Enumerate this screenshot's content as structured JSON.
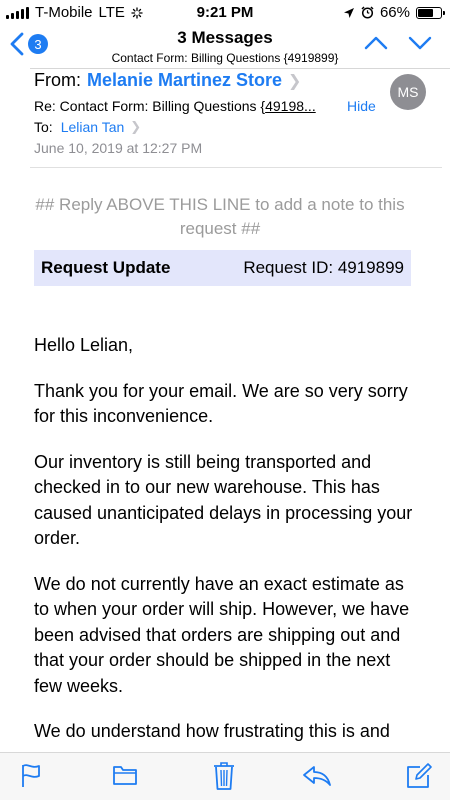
{
  "status_bar": {
    "carrier": "T-Mobile",
    "network": "LTE",
    "time": "9:21 PM",
    "battery": "66%",
    "battery_level": 0.66
  },
  "nav": {
    "back_count": "3",
    "title": "3 Messages",
    "subtitle": "Contact Form: Billing Questions {4919899}"
  },
  "header": {
    "from_label": "From:",
    "sender": "Melanie Martinez Store",
    "avatar_initials": "MS",
    "subject_prefix": "Re: Contact Form: Billing Questions {",
    "subject_truncated": "49198...",
    "hide_label": "Hide",
    "to_label": "To:",
    "recipient": "Lelian Tan",
    "date": "June 10, 2019 at 12:27 PM"
  },
  "body": {
    "reply_note": "## Reply ABOVE THIS LINE to add a note to this request ##",
    "request_label": "Request Update",
    "request_id": "Request ID: 4919899",
    "paragraphs": [
      "Hello Lelian,",
      "Thank you for your email. We are so very sorry for this inconvenience.",
      "Our inventory is still being transported and checked in to our new warehouse. This has caused unanticipated delays in processing your order.",
      "We do not currently have an exact estimate as to when your order will ship. However, we have been advised that orders are shipping out and that your order should be shipped in the next few weeks.",
      "We do understand how frustrating this is and"
    ]
  },
  "toolbar": {
    "icons": [
      "flag-icon",
      "folder-icon",
      "trash-icon",
      "reply-icon",
      "compose-icon"
    ]
  },
  "colors": {
    "accent": "#1e7cf2",
    "request_box": "#e3e6fb",
    "muted": "#8e8e93"
  }
}
